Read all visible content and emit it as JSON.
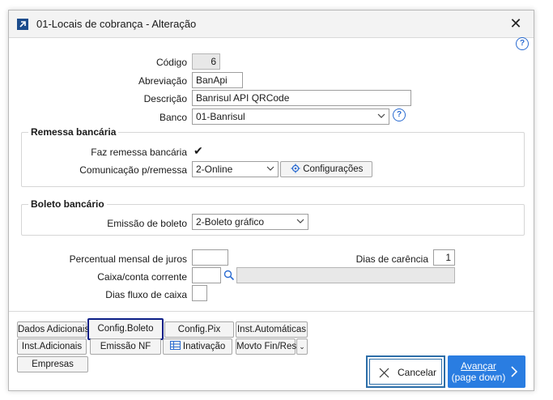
{
  "window": {
    "title": "01-Locais de cobrança - Alteração"
  },
  "form": {
    "codigo_label": "Código",
    "codigo_value": "6",
    "abrev_label": "Abreviação",
    "abrev_value": "BanApi",
    "desc_label": "Descrição",
    "desc_value": "Banrisul API QRCode",
    "banco_label": "Banco",
    "banco_value": "01-Banrisul"
  },
  "remessa": {
    "title": "Remessa bancária",
    "faz_label": "Faz remessa bancária",
    "faz_checked": "✔",
    "com_label": "Comunicação p/remessa",
    "com_value": "2-Online",
    "config_label": "Configurações"
  },
  "boleto": {
    "title": "Boleto bancário",
    "emissao_label": "Emissão de boleto",
    "emissao_value": "2-Boleto gráfico"
  },
  "extra": {
    "juros_label": "Percentual mensal de juros",
    "juros_value": "",
    "carencia_label": "Dias de carência",
    "carencia_value": "1",
    "caixa_label": "Caixa/conta corrente",
    "caixa_value": "",
    "caixa_desc": "",
    "fluxo_label": "Dias fluxo de caixa",
    "fluxo_value": ""
  },
  "tabs": {
    "dados_adicionais": "Dados Adicionais",
    "config_boleto": "Config.Boleto",
    "config_pix": "Config.Pix",
    "inst_automaticas": "Inst.Automáticas",
    "inst_adicionais": "Inst.Adicionais",
    "emissao_nf": "Emissão NF",
    "inativacao": "Inativação",
    "movto": "Movto Fin/Res",
    "empresas": "Empresas"
  },
  "actions": {
    "cancel": "Cancelar",
    "advance": "Avançar",
    "advance_hint": "(page down)"
  },
  "colors": {
    "accent": "#2a7de1",
    "title_icon": "#1c4c8c",
    "selected_border": "#0c1f87"
  }
}
